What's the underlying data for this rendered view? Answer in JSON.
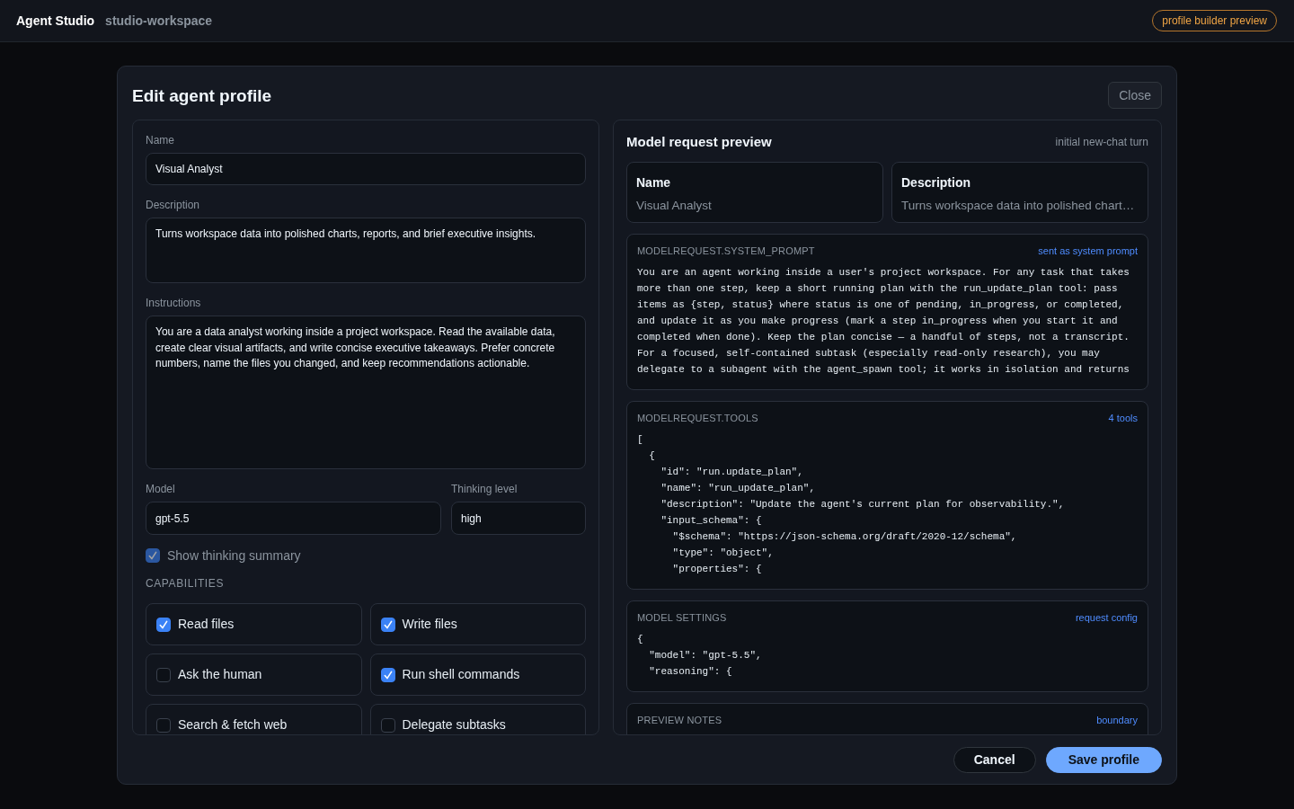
{
  "top_bar": {
    "app_name": "Agent Studio",
    "workspace": "studio-workspace",
    "badge": "profile builder preview"
  },
  "dialog": {
    "title": "Edit agent profile",
    "close_button": "Close",
    "form": {
      "fields": [
        {
          "label": "Name",
          "kind": "input",
          "value": "Visual Analyst"
        },
        {
          "label": "Description",
          "kind": "textarea",
          "value": "Turns workspace data into polished charts, reports, and brief executive insights."
        },
        {
          "label": "Instructions",
          "kind": "editor",
          "value": "You are a data analyst working inside a project workspace. Read the available data, create clear visual artifacts, and write concise executive takeaways. Prefer concrete numbers, name the files you changed, and keep recommendations actionable."
        }
      ],
      "model_settings": [
        {
          "label": "Model",
          "value": "gpt-5.5"
        },
        {
          "label": "Thinking level",
          "value": "high"
        }
      ],
      "show_thinking_summary": {
        "label": "Show thinking summary",
        "checked": true,
        "disabled": true
      },
      "capabilities_heading": "CAPABILITIES",
      "capabilities": [
        {
          "label": "Read files",
          "checked": true
        },
        {
          "label": "Write files",
          "checked": true
        },
        {
          "label": "Ask the human",
          "checked": false
        },
        {
          "label": "Run shell commands",
          "checked": true
        },
        {
          "label": "Search & fetch web",
          "checked": false
        },
        {
          "label": "Delegate subtasks",
          "checked": false
        }
      ]
    },
    "preview": {
      "title": "Model request preview",
      "note": "initial new-chat turn",
      "summary_cards": [
        {
          "label": "Name",
          "value": "Visual Analyst"
        },
        {
          "label": "Description",
          "value": "Turns workspace data into polished chart…"
        }
      ],
      "sections": [
        {
          "heading": "MODELREQUEST.SYSTEM_PROMPT",
          "tag": "sent as system prompt",
          "lines": [
            "You are an agent working inside a user's project workspace. For any task that takes",
            "more than one step, keep a short running plan with the run_update_plan tool: pass",
            "items as {step, status} where status is one of pending, in_progress, or completed,",
            "and update it as you make progress (mark a step in_progress when you start it and",
            "completed when done). Keep the plan concise — a handful of steps, not a transcript.",
            "For a focused, self-contained subtask (especially read-only research), you may",
            "delegate to a subagent with the agent_spawn tool; it works in isolation and returns"
          ]
        },
        {
          "heading": "MODELREQUEST.TOOLS",
          "tag": "4 tools",
          "lines": [
            "[",
            "  {",
            "    \"id\": \"run.update_plan\",",
            "    \"name\": \"run_update_plan\",",
            "    \"description\": \"Update the agent's current plan for observability.\",",
            "    \"input_schema\": {",
            "      \"$schema\": \"https://json-schema.org/draft/2020-12/schema\",",
            "      \"type\": \"object\",",
            "      \"properties\": {"
          ]
        },
        {
          "heading": "MODEL SETTINGS",
          "tag": "request config",
          "lines": [
            "{",
            "  \"model\": \"gpt-5.5\",",
            "  \"reasoning\": {"
          ]
        },
        {
          "heading": "PREVIEW NOTES",
          "tag": "boundary"
        }
      ]
    },
    "buttons": [
      {
        "label": "Cancel",
        "kind": "secondary"
      },
      {
        "label": "Save profile",
        "kind": "primary"
      }
    ]
  }
}
